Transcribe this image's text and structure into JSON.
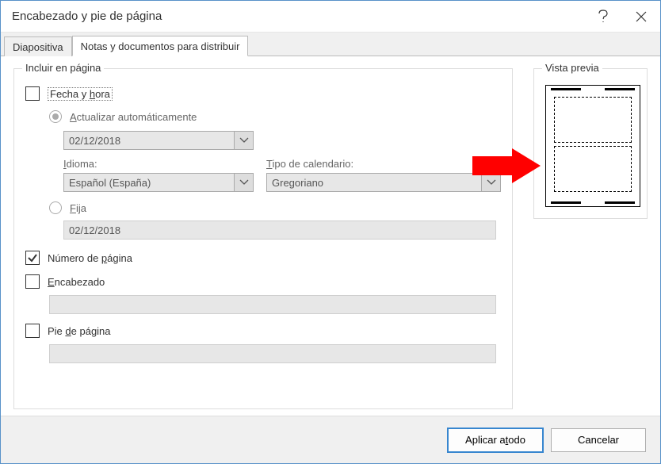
{
  "title": "Encabezado y pie de página",
  "tabs": {
    "slide": "Diapositiva",
    "notes": "Notas y documentos para distribuir"
  },
  "groups": {
    "include": "Incluir en página",
    "preview": "Vista previa"
  },
  "datetime": {
    "label": "Fecha y hora",
    "label_u": "h",
    "auto": "Actualizar automáticamente",
    "auto_u": "A",
    "date_value": "02/12/2018",
    "lang_label": "Idioma:",
    "lang_label_u": "I",
    "lang_value": "Español (España)",
    "cal_label": "Tipo de calendario:",
    "cal_label_u": "T",
    "cal_value": "Gregoriano",
    "fixed": "Fija",
    "fixed_u": "F",
    "fixed_value": "02/12/2018"
  },
  "page_number": {
    "label": "Número de página",
    "u": "p"
  },
  "header": {
    "label": "Encabezado",
    "u": "E"
  },
  "footer": {
    "label": "Pie de página",
    "u": "d"
  },
  "buttons": {
    "apply_all": "Aplicar a todo",
    "apply_all_u": "t",
    "cancel": "Cancelar"
  }
}
